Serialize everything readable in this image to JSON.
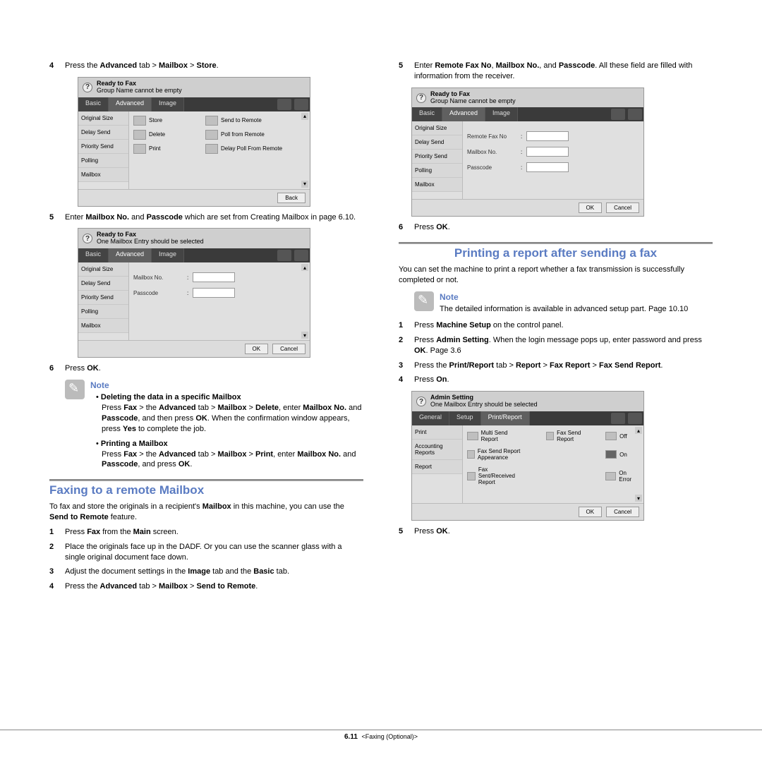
{
  "left": {
    "step4": {
      "num": "4",
      "pre": "Press the ",
      "b1": "Advanced",
      "mid": " tab > ",
      "b2": "Mailbox",
      "mid2": " > ",
      "b3": "Store",
      "post": "."
    },
    "step5": {
      "num": "5",
      "pre": "Enter ",
      "b1": "Mailbox No.",
      "mid": " and ",
      "b2": "Passcode",
      "post": " which are set from Creating Mailbox in page 6.10."
    },
    "step6": {
      "num": "6",
      "pre": "Press ",
      "b1": "OK",
      "post": "."
    },
    "note": {
      "label": "Note",
      "del_title": "Deleting the data in a specific Mailbox",
      "del_body_1": "Press ",
      "del_b1": "Fax",
      "del_body_2": " > the ",
      "del_b2": "Advanced",
      "del_body_3": " tab > ",
      "del_b3": "Mailbox",
      "del_body_4": " > ",
      "del_b4": "Delete",
      "del_body_5": ", enter ",
      "del_b5": "Mailbox No.",
      "del_body_6": " and ",
      "del_b6": "Passcode",
      "del_body_7": ", and then press ",
      "del_b7": "OK",
      "del_body_8": ". When the confirmation window appears, press ",
      "del_b8": "Yes",
      "del_body_9": " to complete the job.",
      "print_title": "Printing a Mailbox",
      "p_body_1": "Press ",
      "p_b1": "Fax",
      "p_body_2": " > the ",
      "p_b2": "Advanced",
      "p_body_3": " tab > ",
      "p_b3": "Mailbox",
      "p_body_4": " > ",
      "p_b4": "Print",
      "p_body_5": ", enter ",
      "p_b5": "Mailbox No.",
      "p_body_6": " and ",
      "p_b6": "Passcode",
      "p_body_7": ", and press ",
      "p_b7": "OK",
      "p_body_8": "."
    },
    "faxing_heading": "Faxing to a remote Mailbox",
    "faxing_para_1": "To fax and store the originals in a recipient's ",
    "faxing_b1": "Mailbox",
    "faxing_para_2": " in this machine, you can use the ",
    "faxing_b2": "Send to Remote",
    "faxing_para_3": " feature.",
    "fs1": {
      "num": "1",
      "pre": "Press ",
      "b1": "Fax",
      "mid": " from the ",
      "b2": "Main",
      "post": " screen."
    },
    "fs2": {
      "num": "2",
      "text": "Place the originals face up in the DADF. Or you can use the scanner glass with a single original document face down."
    },
    "fs3": {
      "num": "3",
      "pre": "Adjust the document settings in the ",
      "b1": "Image",
      "mid": " tab and the ",
      "b2": "Basic",
      "post": " tab."
    },
    "fs4": {
      "num": "4",
      "pre": "Press the ",
      "b1": "Advanced",
      "mid": " tab > ",
      "b2": "Mailbox",
      "mid2": " > ",
      "b3": "Send to Remote",
      "post": "."
    }
  },
  "right": {
    "step5": {
      "num": "5",
      "pre": "Enter ",
      "b1": "Remote Fax No",
      "mid": ", ",
      "b2": "Mailbox No.",
      "mid2": ", and ",
      "b3": "Passcode",
      "post": ". All these field are filled with information from the receiver."
    },
    "step6": {
      "num": "6",
      "pre": "Press ",
      "b1": "OK",
      "post": "."
    },
    "report_heading": "Printing a report after sending a fax",
    "report_para": "You can set the machine to print a report whether a fax transmission is successfully completed or not.",
    "note": {
      "label": "Note",
      "body": "The detailed information is available in advanced setup part. Page 10.10"
    },
    "rs1": {
      "num": "1",
      "pre": "Press ",
      "b1": "Machine Setup",
      "post": " on the control panel."
    },
    "rs2": {
      "num": "2",
      "pre": "Press ",
      "b1": "Admin Setting",
      "post": ". When the login message pops up, enter password and press ",
      "b2": "OK",
      "post2": ". Page 3.6"
    },
    "rs3": {
      "num": "3",
      "pre": "Press the ",
      "b1": "Print/Report",
      "mid": " tab > ",
      "b2": "Report",
      "mid2": " > ",
      "b3": "Fax Report",
      "mid3": " > ",
      "b4": "Fax Send Report",
      "post": "."
    },
    "rs4": {
      "num": "4",
      "pre": "Press ",
      "b1": "On",
      "post": "."
    },
    "rs5": {
      "num": "5",
      "pre": "Press ",
      "b1": "OK",
      "post": "."
    }
  },
  "dev1": {
    "title1": "Ready to Fax",
    "title2": "Group Name cannot be empty",
    "tabs": [
      "Basic",
      "Advanced",
      "Image"
    ],
    "side": [
      "Original Size",
      "Delay Send",
      "Priority Send",
      "Polling",
      "Mailbox"
    ],
    "cells": [
      "Store",
      "Send to Remote",
      "Delete",
      "Poll from Remote",
      "Print",
      "Delay Poll From Remote"
    ],
    "back": "Back"
  },
  "dev2": {
    "title1": "Ready to Fax",
    "title2": "One Mailbox Entry should be selected",
    "tabs": [
      "Basic",
      "Advanced",
      "Image"
    ],
    "side": [
      "Original Size",
      "Delay Send",
      "Priority Send",
      "Polling",
      "Mailbox"
    ],
    "fields": [
      "Mailbox No.",
      "Passcode"
    ],
    "ok": "OK",
    "cancel": "Cancel"
  },
  "dev3": {
    "title1": "Ready to Fax",
    "title2": "Group Name cannot be empty",
    "tabs": [
      "Basic",
      "Advanced",
      "Image"
    ],
    "side": [
      "Original Size",
      "Delay Send",
      "Priority Send",
      "Polling",
      "Mailbox"
    ],
    "fields": [
      "Remote Fax No",
      "Mailbox No.",
      "Passcode"
    ],
    "ok": "OK",
    "cancel": "Cancel"
  },
  "dev4": {
    "title1": "Admin Setting",
    "title2": "One Mailbox Entry should be selected",
    "tabs": [
      "General",
      "Setup",
      "Print/Report"
    ],
    "side": [
      "Print",
      "Accounting Reports",
      "Report"
    ],
    "rows": [
      [
        "Multi Send Report",
        "Fax Send Report",
        "Off"
      ],
      [
        "Fax Send Report Appearance",
        "",
        "On"
      ],
      [
        "Fax Sent/Received Report",
        "",
        "On Error"
      ]
    ],
    "ok": "OK",
    "cancel": "Cancel"
  },
  "footer": {
    "pn": "6.11",
    "label": "<Faxing (Optional)>"
  }
}
